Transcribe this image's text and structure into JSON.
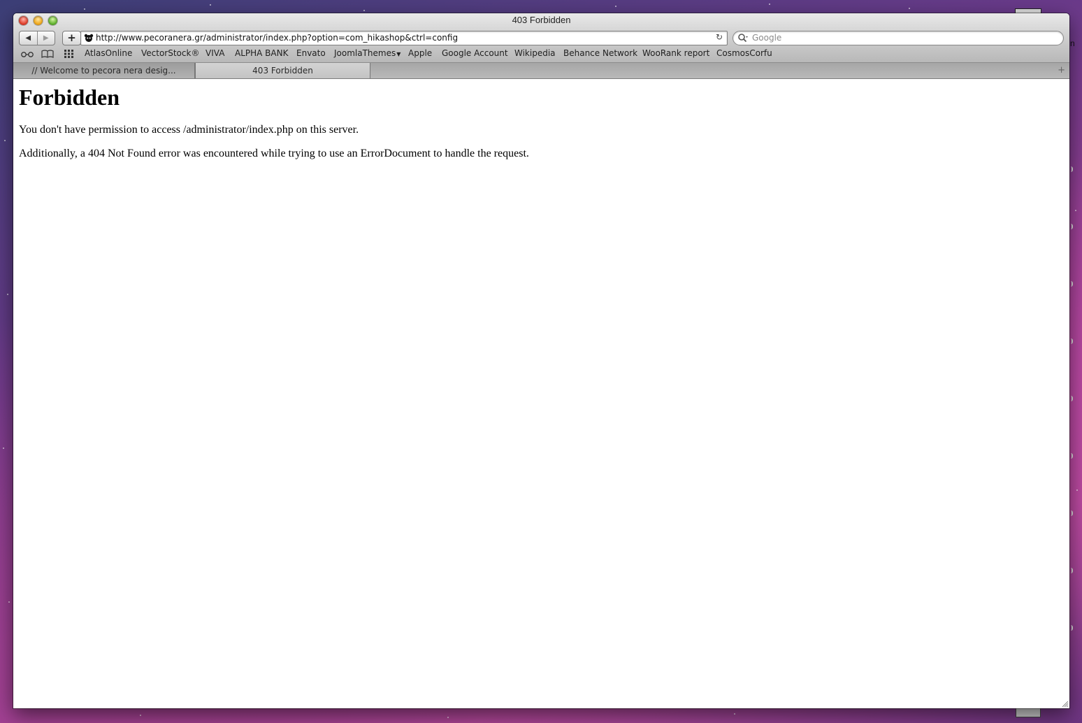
{
  "window": {
    "title": "403 Forbidden"
  },
  "toolbar": {
    "url": "http://www.pecoranera.gr/administrator/index.php?option=com_hikashop&ctrl=config",
    "search_placeholder": "Google"
  },
  "bookmarks": [
    {
      "label": "AtlasOnline"
    },
    {
      "label": "VectorStock®"
    },
    {
      "label": "VIVA"
    },
    {
      "label": "ALPHA BANK"
    },
    {
      "label": "Envato"
    },
    {
      "label": "JoomlaThemes"
    },
    {
      "label": "Apple"
    },
    {
      "label": "Google Account"
    },
    {
      "label": "Wikipedia"
    },
    {
      "label": "Behance Network"
    },
    {
      "label": "WooRank report"
    },
    {
      "label": "CosmosCorfu"
    }
  ],
  "tabs": [
    {
      "label": "// Welcome to pecora nera desig..."
    },
    {
      "label": "403 Forbidden"
    }
  ],
  "page": {
    "heading": "Forbidden",
    "paragraph1": "You don't have permission to access /administrator/index.php on this server.",
    "paragraph2": "Additionally, a 404 Not Found error was encountered while trying to use an ErrorDocument to handle the request."
  },
  "desktop": {
    "edge_letter": "n"
  },
  "colors": {
    "wallpaper_accent": "#b94a9d",
    "titlebar": "#d1d1d1",
    "page_bg": "#ffffff"
  }
}
